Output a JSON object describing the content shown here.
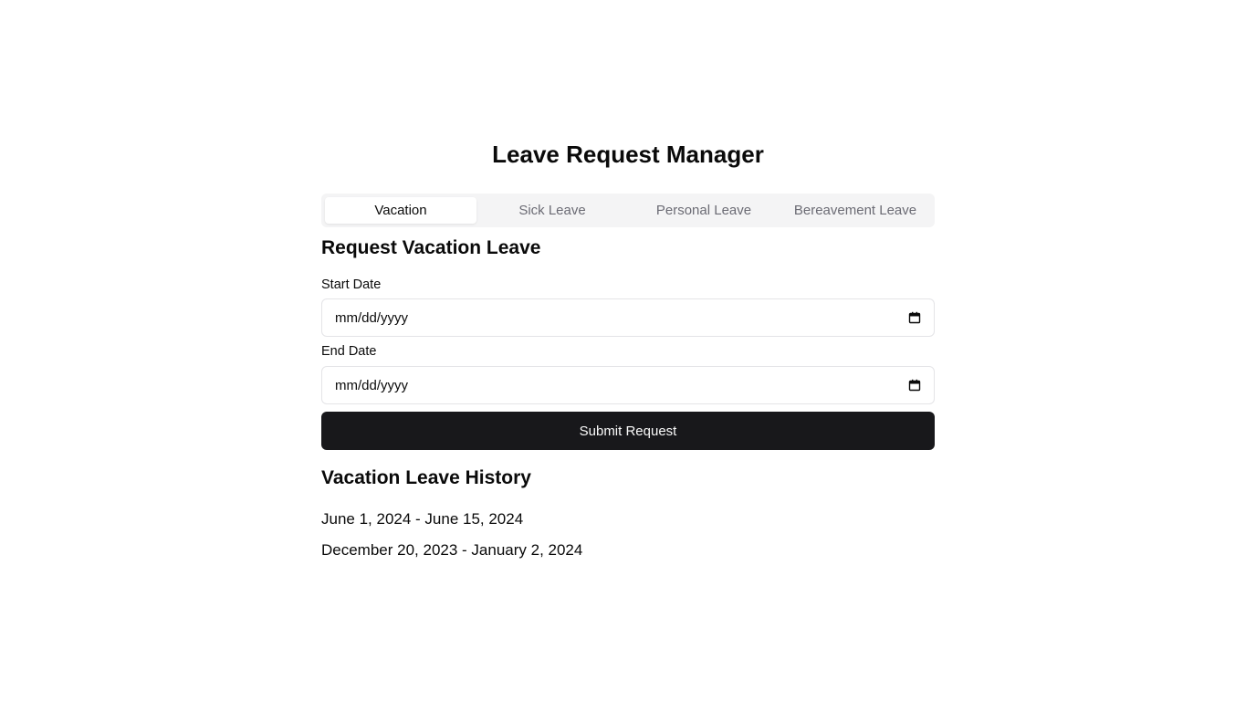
{
  "app": {
    "title": "Leave Request Manager"
  },
  "tabs": [
    {
      "label": "Vacation",
      "active": true
    },
    {
      "label": "Sick Leave",
      "active": false
    },
    {
      "label": "Personal Leave",
      "active": false
    },
    {
      "label": "Bereavement Leave",
      "active": false
    }
  ],
  "form": {
    "title": "Request Vacation Leave",
    "start_date": {
      "label": "Start Date",
      "placeholder": "mm/dd/yyyy",
      "value": "",
      "icon": "calendar-icon"
    },
    "end_date": {
      "label": "End Date",
      "placeholder": "mm/dd/yyyy",
      "value": "",
      "icon": "calendar-icon"
    },
    "submit_label": "Submit Request"
  },
  "history": {
    "title": "Vacation Leave History",
    "items": [
      "June 1, 2024 - June 15, 2024",
      "December 20, 2023 - January 2, 2024"
    ]
  },
  "colors": {
    "primary_button": "#18181b",
    "tab_background": "#f4f4f5",
    "border": "#e4e4e7",
    "muted_text": "#6b6b74"
  }
}
